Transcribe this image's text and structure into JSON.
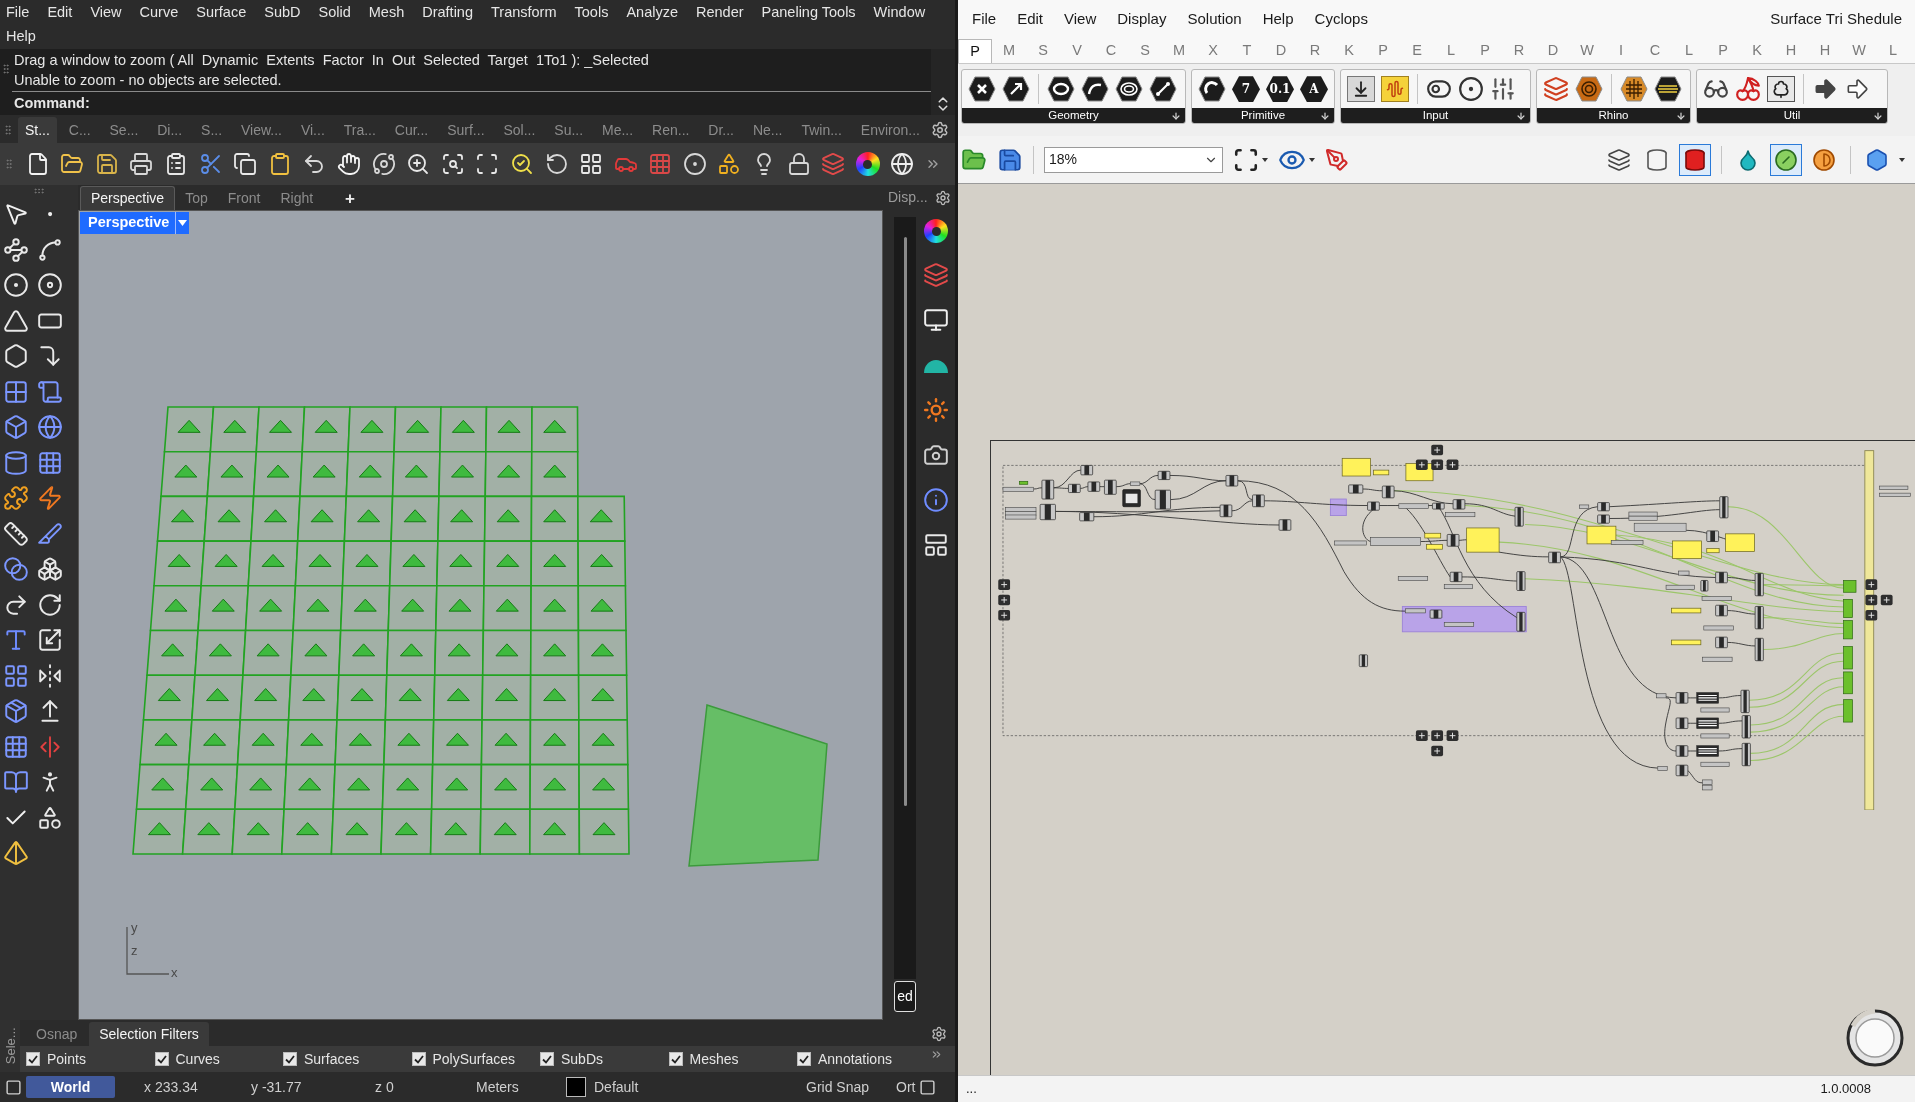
{
  "rhino": {
    "menu": [
      "File",
      "Edit",
      "View",
      "Curve",
      "Surface",
      "SubD",
      "Solid",
      "Mesh",
      "Drafting",
      "Transform",
      "Tools",
      "Analyze",
      "Render",
      "Paneling Tools",
      "Window",
      "Help"
    ],
    "command_history": [
      "Drag a window to zoom ( All  Dynamic  Extents  Factor  In  Out  Selected  Target  1To1 ): _Selected",
      "Unable to zoom - no objects are selected."
    ],
    "command_prompt": "Command:",
    "toolbar_tabs": [
      {
        "label": "St...",
        "selected": true
      },
      {
        "label": "C...",
        "selected": false
      },
      {
        "label": "Se...",
        "selected": false
      },
      {
        "label": "Di...",
        "selected": false
      },
      {
        "label": "S...",
        "selected": false
      },
      {
        "label": "View...",
        "selected": false
      },
      {
        "label": "Vi...",
        "selected": false
      },
      {
        "label": "Tra...",
        "selected": false
      },
      {
        "label": "Cur...",
        "selected": false
      },
      {
        "label": "Surf...",
        "selected": false
      },
      {
        "label": "Sol...",
        "selected": false
      },
      {
        "label": "Su...",
        "selected": false
      },
      {
        "label": "Me...",
        "selected": false
      },
      {
        "label": "Ren...",
        "selected": false
      },
      {
        "label": "Dr...",
        "selected": false
      },
      {
        "label": "Ne...",
        "selected": false
      },
      {
        "label": "Twin...",
        "selected": false
      },
      {
        "label": "Environ...",
        "selected": false
      }
    ],
    "viewport_tabs": [
      {
        "label": "Perspective",
        "selected": true
      },
      {
        "label": "Top",
        "selected": false
      },
      {
        "label": "Front",
        "selected": false
      },
      {
        "label": "Right",
        "selected": false
      }
    ],
    "new_tab": "+",
    "panel_tab": "Disp...",
    "viewport": {
      "title": "Perspective",
      "axis_labels": [
        "y",
        "z",
        "x"
      ]
    },
    "side_button": "ed",
    "panel_side_label": "Sele...",
    "panel_tabs": [
      {
        "label": "Osnap",
        "selected": false
      },
      {
        "label": "Selection Filters",
        "selected": true
      }
    ],
    "filters": [
      {
        "label": "Points",
        "checked": true
      },
      {
        "label": "Curves",
        "checked": true
      },
      {
        "label": "Surfaces",
        "checked": true
      },
      {
        "label": "PolySurfaces",
        "checked": true
      },
      {
        "label": "SubDs",
        "checked": true
      },
      {
        "label": "Meshes",
        "checked": true
      },
      {
        "label": "Annotations",
        "checked": true
      }
    ],
    "status_bar": {
      "plane": "World",
      "x": "x 233.34",
      "y": "y -31.77",
      "z": "z 0",
      "units": "Meters",
      "layer": "Default",
      "grid_snap": "Grid Snap",
      "ortho": "Ort"
    }
  },
  "grasshopper": {
    "menu": [
      "File",
      "Edit",
      "View",
      "Display",
      "Solution",
      "Help",
      "Cyclops"
    ],
    "document_title": "Surface Tri Shedule",
    "tabs": [
      {
        "label": "P",
        "selected": true
      },
      {
        "label": "M",
        "selected": false
      },
      {
        "label": "S",
        "selected": false
      },
      {
        "label": "V",
        "selected": false
      },
      {
        "label": "C",
        "selected": false
      },
      {
        "label": "S",
        "selected": false
      },
      {
        "label": "M",
        "selected": false
      },
      {
        "label": "X",
        "selected": false
      },
      {
        "label": "T",
        "selected": false
      },
      {
        "label": "D",
        "selected": false
      },
      {
        "label": "R",
        "selected": false
      },
      {
        "label": "K",
        "selected": false
      },
      {
        "label": "P",
        "selected": false
      },
      {
        "label": "E",
        "selected": false
      },
      {
        "label": "L",
        "selected": false
      },
      {
        "label": "P",
        "selected": false
      },
      {
        "label": "R",
        "selected": false
      },
      {
        "label": "D",
        "selected": false
      },
      {
        "label": "W",
        "selected": false
      },
      {
        "label": "I",
        "selected": false
      },
      {
        "label": "C",
        "selected": false
      },
      {
        "label": "L",
        "selected": false
      },
      {
        "label": "P",
        "selected": false
      },
      {
        "label": "K",
        "selected": false
      },
      {
        "label": "H",
        "selected": false
      },
      {
        "label": "H",
        "selected": false
      },
      {
        "label": "W",
        "selected": false
      },
      {
        "label": "L",
        "selected": false
      }
    ],
    "panels": [
      {
        "label": "Geometry"
      },
      {
        "label": "Primitive",
        "glyphs": [
          "7",
          "0.1",
          "A"
        ]
      },
      {
        "label": "Input"
      },
      {
        "label": "Rhino"
      },
      {
        "label": "Util"
      }
    ],
    "zoom": "18%",
    "display_toggles": [
      {
        "on": false
      },
      {
        "on": false
      },
      {
        "on": true
      },
      {
        "on": false
      },
      {
        "on": true
      },
      {
        "on": false
      },
      {
        "on": false
      }
    ],
    "status": "...",
    "version": "1.0.0008"
  }
}
